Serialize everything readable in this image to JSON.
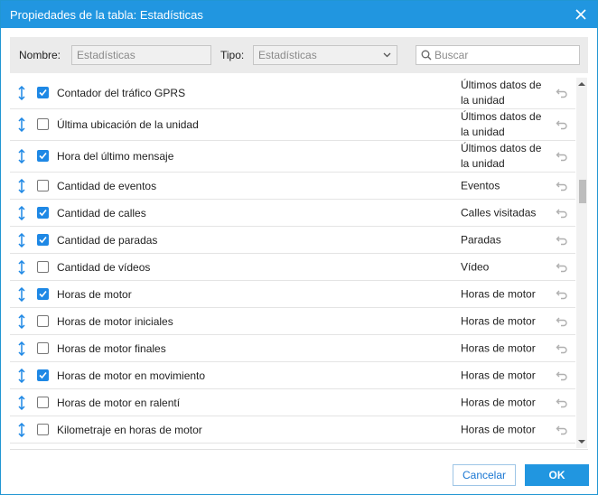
{
  "dialog": {
    "title": "Propiedades de la tabla: Estadísticas"
  },
  "filters": {
    "name_label": "Nombre:",
    "name_value": "Estadísticas",
    "type_label": "Tipo:",
    "type_value": "Estadísticas",
    "search_placeholder": "Buscar"
  },
  "rows": [
    {
      "name": "Contador del tráfico GPRS",
      "type": "Últimos datos de la unidad",
      "checked": true
    },
    {
      "name": "Última ubicación de la unidad",
      "type": "Últimos datos de la unidad",
      "checked": false
    },
    {
      "name": "Hora del último mensaje",
      "type": "Últimos datos de la unidad",
      "checked": true
    },
    {
      "name": "Cantidad de eventos",
      "type": "Eventos",
      "checked": false
    },
    {
      "name": "Cantidad de calles",
      "type": "Calles visitadas",
      "checked": true
    },
    {
      "name": "Cantidad de paradas",
      "type": "Paradas",
      "checked": true
    },
    {
      "name": "Cantidad de vídeos",
      "type": "Vídeo",
      "checked": false
    },
    {
      "name": "Horas de motor",
      "type": "Horas de motor",
      "checked": true
    },
    {
      "name": "Horas de motor iniciales",
      "type": "Horas de motor",
      "checked": false
    },
    {
      "name": "Horas de motor finales",
      "type": "Horas de motor",
      "checked": false
    },
    {
      "name": "Horas de motor en movimiento",
      "type": "Horas de motor",
      "checked": true
    },
    {
      "name": "Horas de motor en ralentí",
      "type": "Horas de motor",
      "checked": false
    },
    {
      "name": "Kilometraje en horas de motor",
      "type": "Horas de motor",
      "checked": false
    }
  ],
  "footer": {
    "cancel_label": "Cancelar",
    "ok_label": "OK"
  },
  "colors": {
    "accent": "#2196e0",
    "checkbox_on": "#1e88e5"
  }
}
